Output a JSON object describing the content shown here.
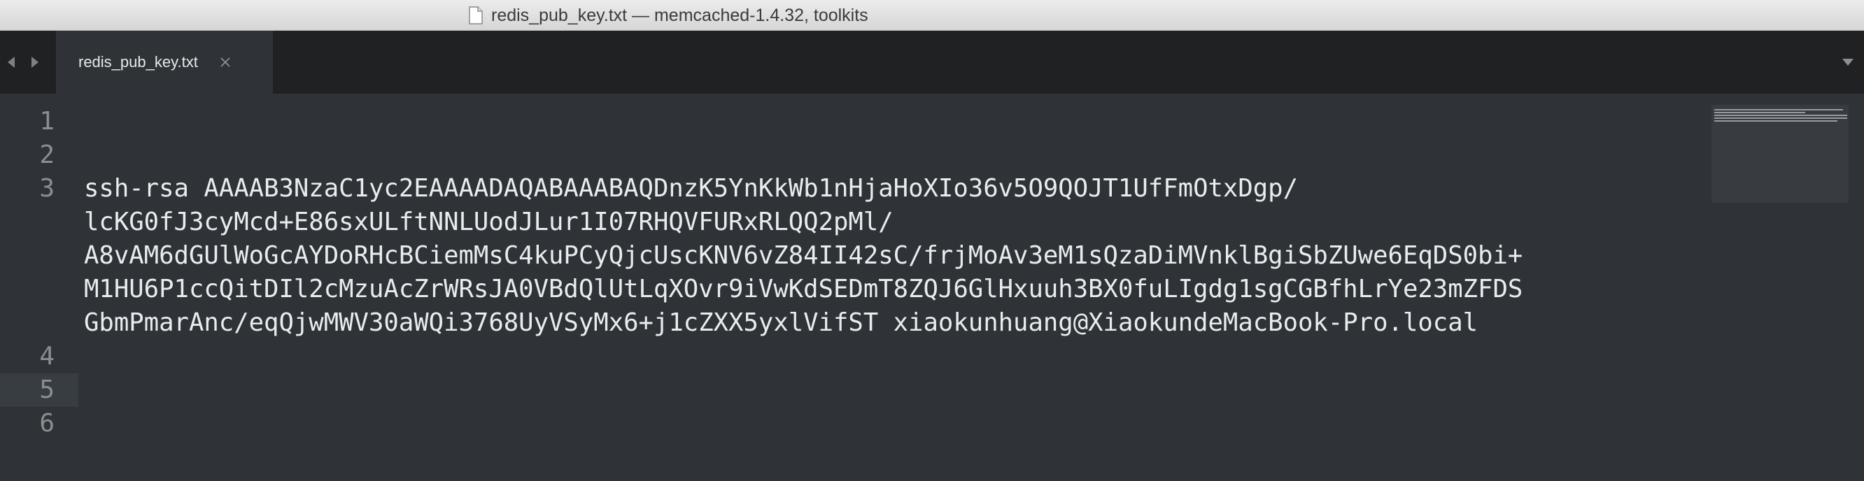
{
  "window": {
    "title": "redis_pub_key.txt — memcached-1.4.32, toolkits",
    "icon": "text-document-icon"
  },
  "tabs": [
    {
      "label": "redis_pub_key.txt",
      "active": true
    }
  ],
  "editor": {
    "current_line": 5,
    "line_numbers": [
      "1",
      "2",
      "3",
      "4",
      "5",
      "6"
    ],
    "lines": [
      "",
      "",
      "ssh-rsa AAAAB3NzaC1yc2EAAAADAQABAAABAQDnzK5YnKkWb1nHjaHoXIo36v5O9QOJT1UfFmOtxDgp/",
      "lcKG0fJ3cyMcd+E86sxULftNNLUodJLur1I07RHQVFURxRLQQ2pMl/",
      "A8vAM6dGUlWoGcAYDoRHcBCiemMsC4kuPCyQjcUscKNV6vZ84II42sC/frjMoAv3eM1sQzaDiMVnklBgiSbZUwe6EqDS0bi+",
      "M1HU6P1ccQitDIl2cMzuAcZrWRsJA0VBdQlUtLqXOvr9iVwKdSEDmT8ZQJ6GlHxuuh3BX0fuLIgdg1sgCGBfhLrYe23mZFDS",
      "GbmPmarAnc/eqQjwMWV30aWQi3768UyVSyMx6+j1cZXX5yxlVifST xiaokunhuang@XiaokundeMacBook-Pro.local",
      "",
      ""
    ]
  },
  "colors": {
    "titlebar_bg": "#e3e3e3",
    "tabbar_bg": "#1f2123",
    "editor_bg": "#2f3337",
    "text": "#e9ecee",
    "gutter_text": "#8b8e91"
  }
}
